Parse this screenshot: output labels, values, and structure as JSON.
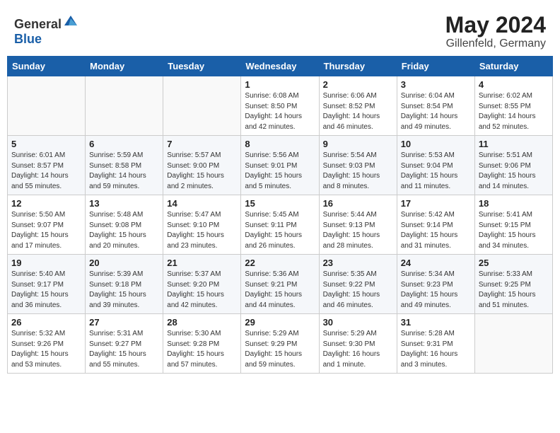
{
  "header": {
    "logo_general": "General",
    "logo_blue": "Blue",
    "main_title": "May 2024",
    "subtitle": "Gillenfeld, Germany"
  },
  "weekdays": [
    "Sunday",
    "Monday",
    "Tuesday",
    "Wednesday",
    "Thursday",
    "Friday",
    "Saturday"
  ],
  "weeks": [
    [
      {
        "day": "",
        "info": ""
      },
      {
        "day": "",
        "info": ""
      },
      {
        "day": "",
        "info": ""
      },
      {
        "day": "1",
        "info": "Sunrise: 6:08 AM\nSunset: 8:50 PM\nDaylight: 14 hours\nand 42 minutes."
      },
      {
        "day": "2",
        "info": "Sunrise: 6:06 AM\nSunset: 8:52 PM\nDaylight: 14 hours\nand 46 minutes."
      },
      {
        "day": "3",
        "info": "Sunrise: 6:04 AM\nSunset: 8:54 PM\nDaylight: 14 hours\nand 49 minutes."
      },
      {
        "day": "4",
        "info": "Sunrise: 6:02 AM\nSunset: 8:55 PM\nDaylight: 14 hours\nand 52 minutes."
      }
    ],
    [
      {
        "day": "5",
        "info": "Sunrise: 6:01 AM\nSunset: 8:57 PM\nDaylight: 14 hours\nand 55 minutes."
      },
      {
        "day": "6",
        "info": "Sunrise: 5:59 AM\nSunset: 8:58 PM\nDaylight: 14 hours\nand 59 minutes."
      },
      {
        "day": "7",
        "info": "Sunrise: 5:57 AM\nSunset: 9:00 PM\nDaylight: 15 hours\nand 2 minutes."
      },
      {
        "day": "8",
        "info": "Sunrise: 5:56 AM\nSunset: 9:01 PM\nDaylight: 15 hours\nand 5 minutes."
      },
      {
        "day": "9",
        "info": "Sunrise: 5:54 AM\nSunset: 9:03 PM\nDaylight: 15 hours\nand 8 minutes."
      },
      {
        "day": "10",
        "info": "Sunrise: 5:53 AM\nSunset: 9:04 PM\nDaylight: 15 hours\nand 11 minutes."
      },
      {
        "day": "11",
        "info": "Sunrise: 5:51 AM\nSunset: 9:06 PM\nDaylight: 15 hours\nand 14 minutes."
      }
    ],
    [
      {
        "day": "12",
        "info": "Sunrise: 5:50 AM\nSunset: 9:07 PM\nDaylight: 15 hours\nand 17 minutes."
      },
      {
        "day": "13",
        "info": "Sunrise: 5:48 AM\nSunset: 9:08 PM\nDaylight: 15 hours\nand 20 minutes."
      },
      {
        "day": "14",
        "info": "Sunrise: 5:47 AM\nSunset: 9:10 PM\nDaylight: 15 hours\nand 23 minutes."
      },
      {
        "day": "15",
        "info": "Sunrise: 5:45 AM\nSunset: 9:11 PM\nDaylight: 15 hours\nand 26 minutes."
      },
      {
        "day": "16",
        "info": "Sunrise: 5:44 AM\nSunset: 9:13 PM\nDaylight: 15 hours\nand 28 minutes."
      },
      {
        "day": "17",
        "info": "Sunrise: 5:42 AM\nSunset: 9:14 PM\nDaylight: 15 hours\nand 31 minutes."
      },
      {
        "day": "18",
        "info": "Sunrise: 5:41 AM\nSunset: 9:15 PM\nDaylight: 15 hours\nand 34 minutes."
      }
    ],
    [
      {
        "day": "19",
        "info": "Sunrise: 5:40 AM\nSunset: 9:17 PM\nDaylight: 15 hours\nand 36 minutes."
      },
      {
        "day": "20",
        "info": "Sunrise: 5:39 AM\nSunset: 9:18 PM\nDaylight: 15 hours\nand 39 minutes."
      },
      {
        "day": "21",
        "info": "Sunrise: 5:37 AM\nSunset: 9:20 PM\nDaylight: 15 hours\nand 42 minutes."
      },
      {
        "day": "22",
        "info": "Sunrise: 5:36 AM\nSunset: 9:21 PM\nDaylight: 15 hours\nand 44 minutes."
      },
      {
        "day": "23",
        "info": "Sunrise: 5:35 AM\nSunset: 9:22 PM\nDaylight: 15 hours\nand 46 minutes."
      },
      {
        "day": "24",
        "info": "Sunrise: 5:34 AM\nSunset: 9:23 PM\nDaylight: 15 hours\nand 49 minutes."
      },
      {
        "day": "25",
        "info": "Sunrise: 5:33 AM\nSunset: 9:25 PM\nDaylight: 15 hours\nand 51 minutes."
      }
    ],
    [
      {
        "day": "26",
        "info": "Sunrise: 5:32 AM\nSunset: 9:26 PM\nDaylight: 15 hours\nand 53 minutes."
      },
      {
        "day": "27",
        "info": "Sunrise: 5:31 AM\nSunset: 9:27 PM\nDaylight: 15 hours\nand 55 minutes."
      },
      {
        "day": "28",
        "info": "Sunrise: 5:30 AM\nSunset: 9:28 PM\nDaylight: 15 hours\nand 57 minutes."
      },
      {
        "day": "29",
        "info": "Sunrise: 5:29 AM\nSunset: 9:29 PM\nDaylight: 15 hours\nand 59 minutes."
      },
      {
        "day": "30",
        "info": "Sunrise: 5:29 AM\nSunset: 9:30 PM\nDaylight: 16 hours\nand 1 minute."
      },
      {
        "day": "31",
        "info": "Sunrise: 5:28 AM\nSunset: 9:31 PM\nDaylight: 16 hours\nand 3 minutes."
      },
      {
        "day": "",
        "info": ""
      }
    ]
  ]
}
